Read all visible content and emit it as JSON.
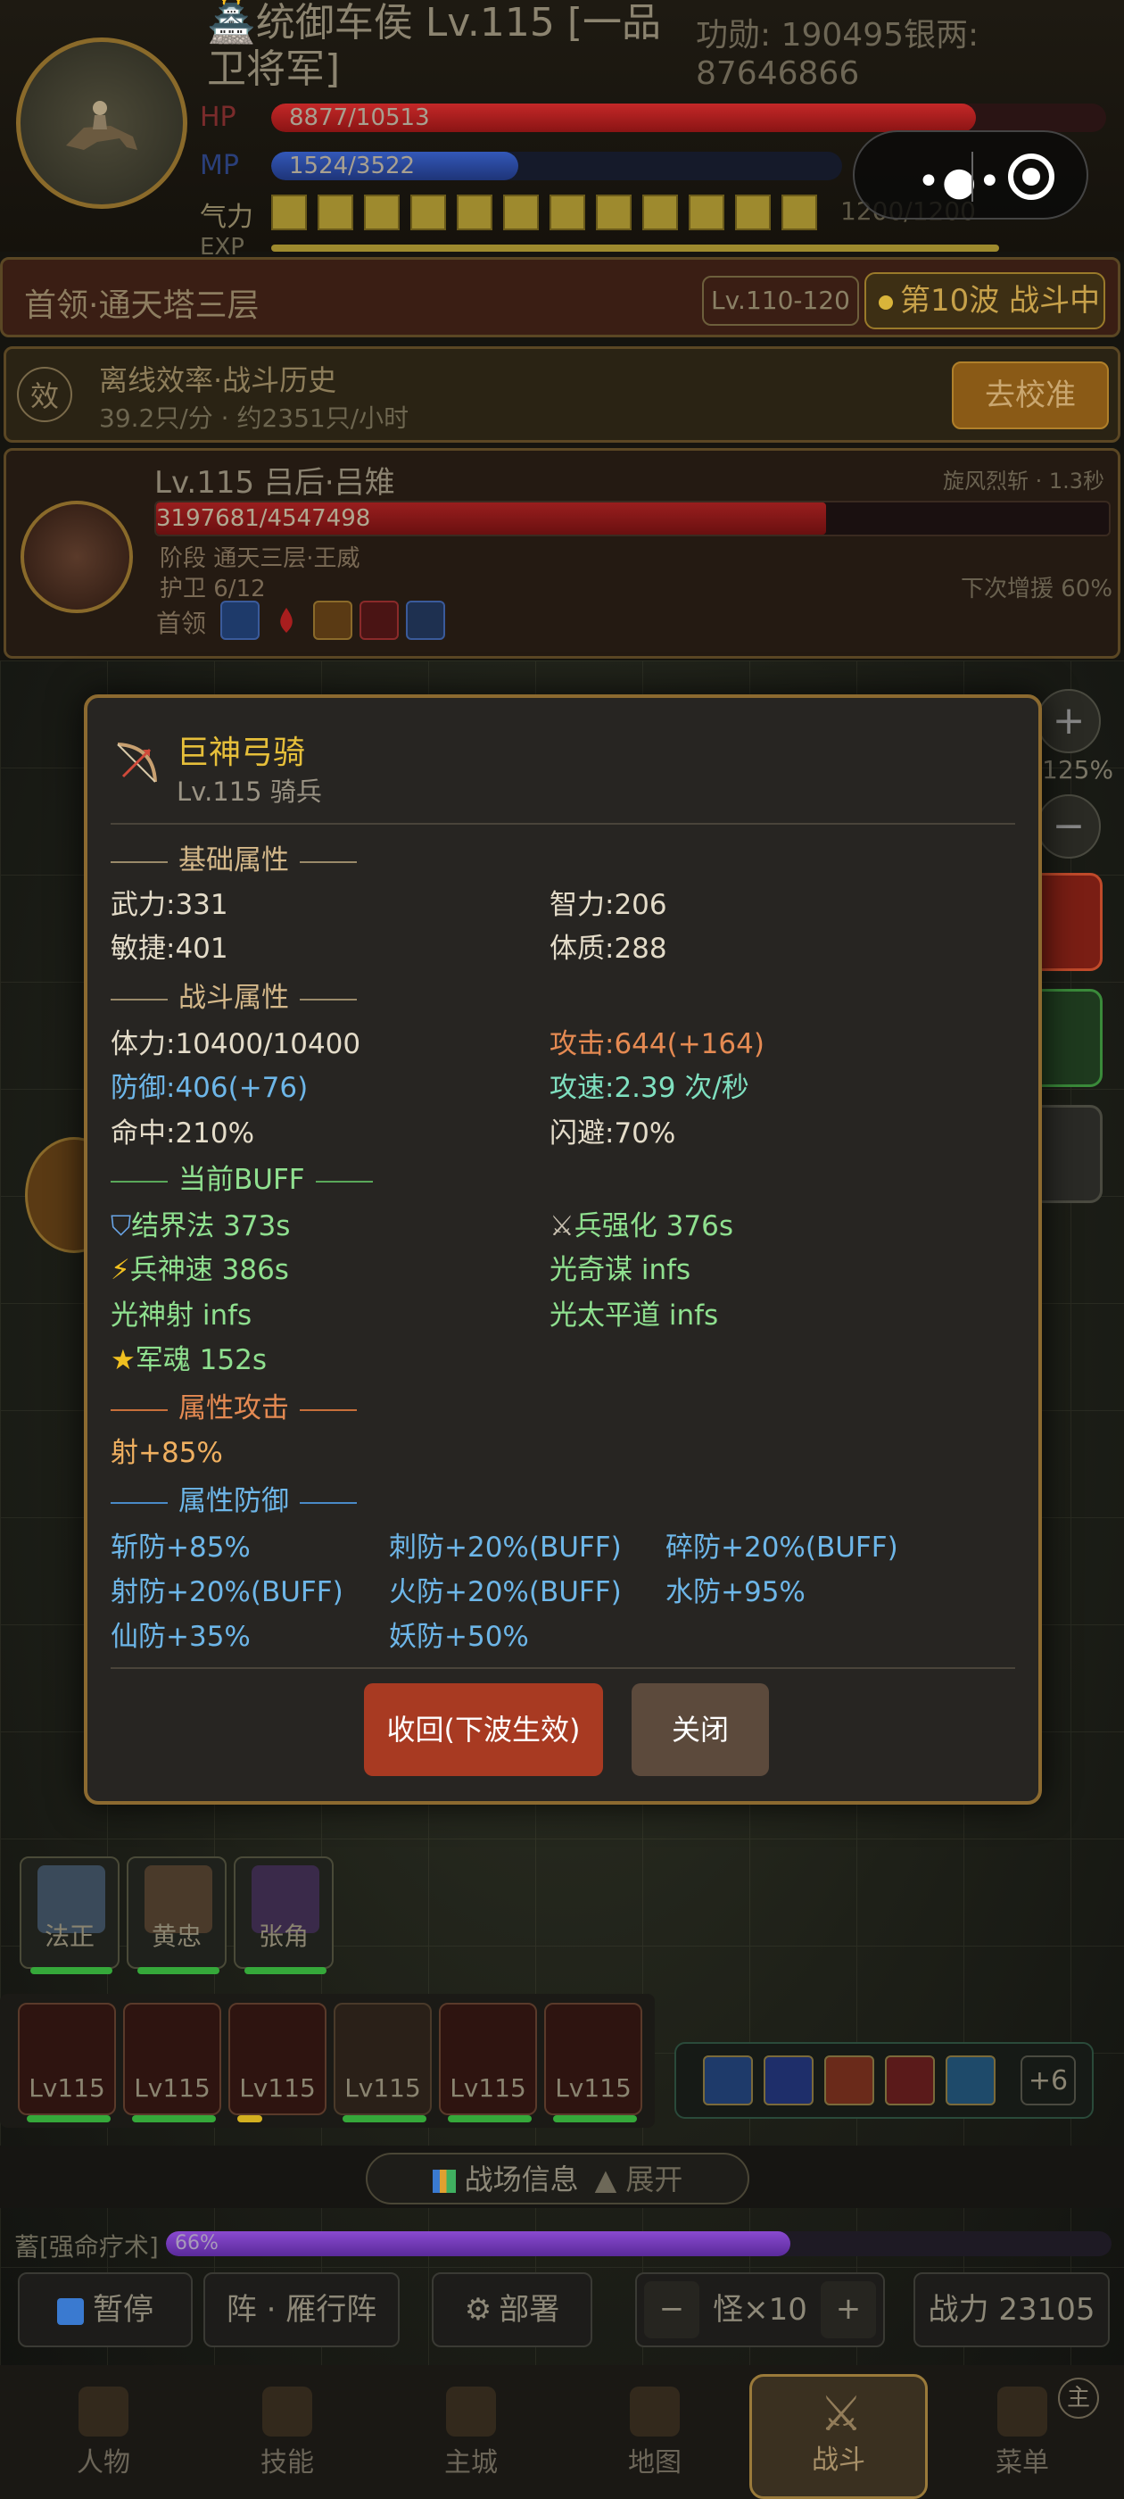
{
  "hero": {
    "title": "🏯统御车侯 Lv.115 [一品卫将军]",
    "merit_silver": "功勋: 190495银两: 87646866",
    "hp_label": "HP",
    "hp_text": "8877/10513",
    "hp_fraction": 0.8444,
    "mp_label": "MP",
    "mp_text": "1524/3522",
    "mp_fraction": 0.4327,
    "qi_label": "气力",
    "qi_text": "1200/1200",
    "exp_label": "EXP"
  },
  "miniprogram": {
    "more_icon": "more-dots-icon",
    "close_icon": "target-close-icon"
  },
  "stage": {
    "name": "首领·通天塔三层",
    "level_range": "Lv.110-120",
    "wave": "第10波 战斗中"
  },
  "efficiency": {
    "badge": "效",
    "title": "离线效率·战斗历史",
    "rate": "39.2只/分 · 约2351只/小时",
    "calibrate_button": "去校准"
  },
  "boss": {
    "name": "Lv.115 吕后·吕雉",
    "skill": "旋风烈斩 · 1.3秒",
    "hp_text": "3197681/4547498",
    "hp_fraction": 0.7032,
    "phase": "阶段  通天三层·王威",
    "guards": "护卫 6/12",
    "next_boost": "下次增援 60%",
    "tag": "首领",
    "status_icons": [
      "down-arrow-icon",
      "blood-drop-icon",
      "slash-icon",
      "omega-icon",
      "shield-icon"
    ]
  },
  "side_controls": {
    "zoom_in": "+",
    "zoom_out": "−",
    "zoom_level": "125%"
  },
  "modal": {
    "name": "巨神弓骑",
    "level_type": "Lv.115 骑兵",
    "icon": "bow-icon",
    "sections": {
      "base": "基础属性",
      "combat": "战斗属性",
      "buff": "当前BUFF",
      "attr_attack": "属性攻击",
      "attr_defense": "属性防御"
    },
    "base_stats": {
      "wuli": "武力:331",
      "zhili": "智力:206",
      "minjie": "敏捷:401",
      "tizhi": "体质:288"
    },
    "combat_stats": {
      "tili": "体力:10400/10400",
      "attack": "攻击:644(+164)",
      "defense": "防御:406(+76)",
      "speed": "攻速:2.39 次/秒",
      "hit": "命中:210%",
      "dodge": "闪避:70%"
    },
    "buffs": [
      {
        "text": "结界法 373s",
        "icon": "shield-icon"
      },
      {
        "text": "兵强化 376s",
        "icon": "crossed-swords-icon"
      },
      {
        "text": "兵神速 386s",
        "icon": "lightning-icon"
      },
      {
        "text": "光奇谋 infs",
        "icon": ""
      },
      {
        "text": "光神射 infs",
        "icon": ""
      },
      {
        "text": "光太平道 infs",
        "icon": ""
      },
      {
        "text": "军魂 152s",
        "icon": "star-icon"
      }
    ],
    "attr_attack": [
      "射+85%"
    ],
    "attr_defense": [
      "斩防+85%",
      "刺防+20%(BUFF)",
      "碎防+20%(BUFF)",
      "射防+20%(BUFF)",
      "火防+20%(BUFF)",
      "水防+95%",
      "仙防+35%",
      "妖防+50%"
    ],
    "recall_button": "收回(下波生效)",
    "close_button": "关闭"
  },
  "generals": [
    {
      "name": "法正"
    },
    {
      "name": "黄忠"
    },
    {
      "name": "张角"
    }
  ],
  "units": [
    {
      "level": "Lv115"
    },
    {
      "level": "Lv115"
    },
    {
      "level": "Lv115"
    },
    {
      "level": "Lv115"
    },
    {
      "level": "Lv115"
    },
    {
      "level": "Lv115"
    }
  ],
  "skill_bar": {
    "more": "+6"
  },
  "battle_info": {
    "label": "战场信息",
    "expand": "▲ 展开"
  },
  "charge": {
    "label": "蓄[强命疗术]",
    "percent": "66%",
    "fraction": 0.66
  },
  "controls": {
    "pause": "暂停",
    "formation": "阵 · 雁行阵",
    "deploy": "部署",
    "monster_minus": "−",
    "monster_count": "怪×10",
    "monster_plus": "+",
    "power": "战力 23105"
  },
  "nav": [
    {
      "label": "人物",
      "icon": "character-icon"
    },
    {
      "label": "技能",
      "icon": "scroll-icon"
    },
    {
      "label": "主城",
      "icon": "castle-icon"
    },
    {
      "label": "地图",
      "icon": "map-icon"
    },
    {
      "label": "战斗",
      "icon": "crossed-swords-icon"
    },
    {
      "label": "菜单",
      "icon": "menu-icon"
    }
  ],
  "nav_badge": "主",
  "colors": {
    "gold": "#e6bf3a",
    "hp_red": "#b52020",
    "mp_blue": "#2a4fa8",
    "buff_green": "#8fe08f",
    "attack_orange": "#e58a52",
    "defense_blue": "#6db6e8",
    "recall_red": "#a83a22"
  }
}
